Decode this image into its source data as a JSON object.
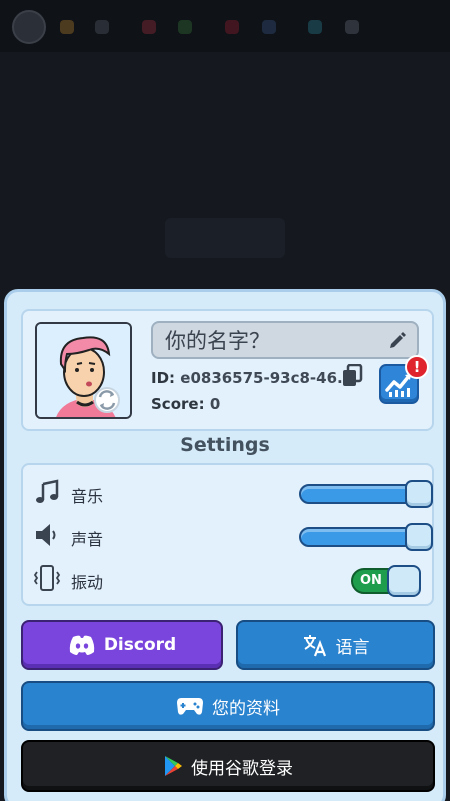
{
  "profile": {
    "name_placeholder": "你的名字？",
    "id_label": "ID:",
    "id_value": "e0836575-93c8-46...",
    "score_label": "Score:",
    "score_value": "0",
    "alert_badge": "!"
  },
  "settings": {
    "title": "Settings",
    "music": {
      "label": "音乐",
      "level": 1.0
    },
    "sound": {
      "label": "声音",
      "level": 1.0
    },
    "vibration": {
      "label": "振动",
      "state": "ON"
    }
  },
  "buttons": {
    "discord": "Discord",
    "language": "语言",
    "your_profile": "您的资料",
    "google_login": "使用谷歌登录"
  },
  "colors": {
    "panel_bg": "#d6ebfa",
    "discord": "#7a45dc",
    "primary_blue": "#2a83cf",
    "toggle_on": "#1e9e4d",
    "alert": "#e0242e"
  }
}
